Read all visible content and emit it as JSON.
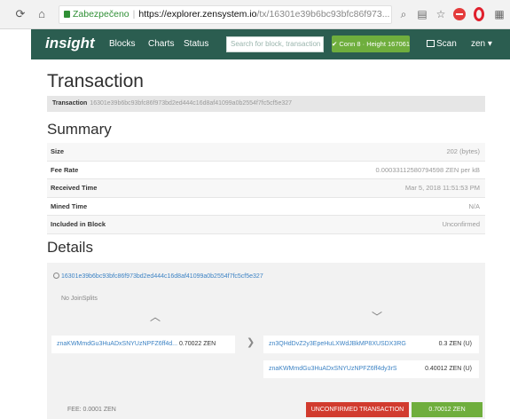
{
  "browser": {
    "secure_label": "Zabezpečeno",
    "url_host": "https://explorer.zensystem.io",
    "url_path": "/tx/16301e39b6bc93bfc86f973..."
  },
  "nav": {
    "logo": "insight",
    "blocks": "Blocks",
    "charts": "Charts",
    "status": "Status",
    "search_placeholder": "Search for block, transaction",
    "connection": "✔ Conn 8 · Height 167061",
    "scan": "Scan",
    "coin": "zen ▾"
  },
  "page": {
    "title": "Transaction",
    "tx_label": "Transaction",
    "tx_hash": "16301e39b6bc93bfc86f973bd2ed444c16d8af41099a0b2554f7fc5cf5e327"
  },
  "summary": {
    "heading": "Summary",
    "rows": [
      {
        "key": "Size",
        "value": "202 (bytes)"
      },
      {
        "key": "Fee Rate",
        "value": "0.00033112580794598 ZEN per kB"
      },
      {
        "key": "Received Time",
        "value": "Mar 5, 2018 11:51:53 PM"
      },
      {
        "key": "Mined Time",
        "value": "N/A"
      },
      {
        "key": "Included in Block",
        "value": "Unconfirmed"
      }
    ]
  },
  "details": {
    "heading": "Details",
    "txid": "16301e39b6bc93bfc86f973bd2ed444c16d8af41099a0b2554f7fc5cf5e327",
    "joinsplits": "No JoinSplits",
    "input": {
      "address": "znaKWMmdGu3HuADxSNYUzNPFZ6ff4d...",
      "amount": "0.70022 ZEN"
    },
    "outputs": [
      {
        "address": "zn3QHdDvZ2y3EpeHuLXWdJBkMP8XUSDX3RG",
        "amount": "0.3 ZEN (U)"
      },
      {
        "address": "znaKWMmdGu3HuADxSNYUzNPFZ6ff4dy3rS",
        "amount": "0.40012 ZEN (U)"
      }
    ],
    "fee": "FEE: 0.0001 ZEN",
    "status": "UNCONFIRMED TRANSACTION",
    "total": "0.70012 ZEN"
  }
}
